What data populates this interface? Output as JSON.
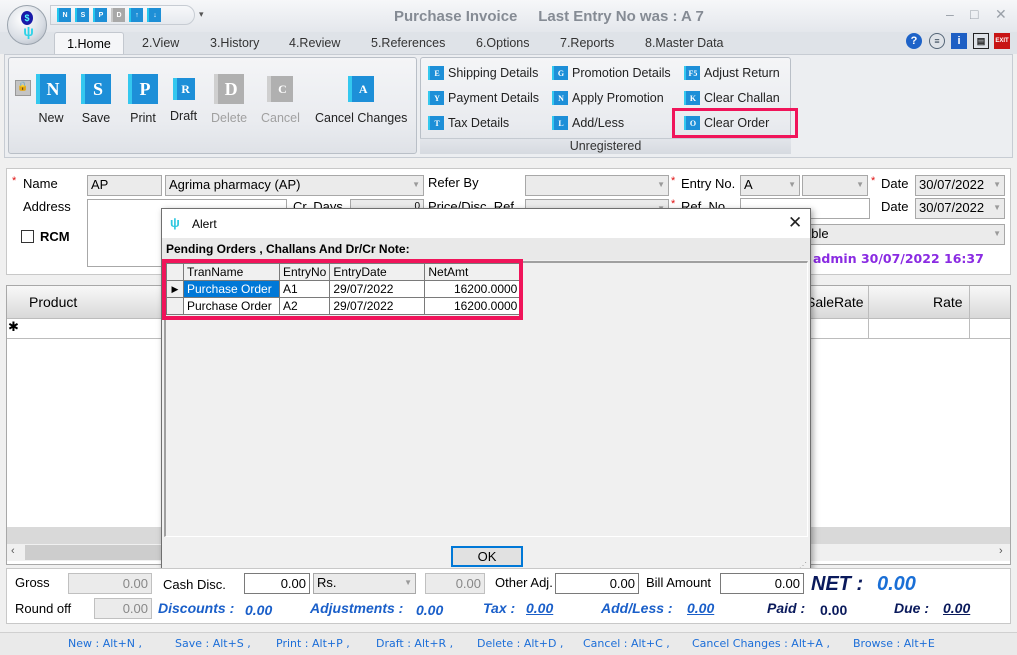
{
  "window": {
    "title": "Purchase Invoice",
    "last_entry": "Last Entry No was : A 7",
    "controls": {
      "minimize": "–",
      "maximize": "□",
      "close": "✕"
    }
  },
  "quick_access": [
    "N",
    "S",
    "P",
    "D",
    "↑",
    "↓"
  ],
  "tabs": [
    {
      "label": "1.Home",
      "active": true
    },
    {
      "label": "2.View"
    },
    {
      "label": "3.History"
    },
    {
      "label": "4.Review"
    },
    {
      "label": "5.References"
    },
    {
      "label": "6.Options"
    },
    {
      "label": "7.Reports"
    },
    {
      "label": "8.Master Data"
    }
  ],
  "top_icons": [
    {
      "name": "help-icon",
      "glyph": "?"
    },
    {
      "name": "database-icon",
      "glyph": "≡"
    },
    {
      "name": "info-icon",
      "glyph": "i"
    },
    {
      "name": "document-icon",
      "glyph": "▤"
    },
    {
      "name": "exit-icon",
      "glyph": "EXIT"
    }
  ],
  "ribbon": {
    "main_buttons": [
      {
        "label": "New",
        "glyph": "N",
        "enabled": true
      },
      {
        "label": "Save",
        "glyph": "S",
        "enabled": true
      },
      {
        "label": "Print",
        "glyph": "P",
        "enabled": true
      },
      {
        "label": "Draft",
        "glyph": "R",
        "enabled": true
      },
      {
        "label": "Delete",
        "glyph": "D",
        "enabled": false
      },
      {
        "label": "Cancel",
        "glyph": "C",
        "enabled": false
      },
      {
        "label": "Cancel Changes",
        "glyph": "A",
        "enabled": true
      }
    ],
    "group_label": "Unregistered",
    "small_buttons": [
      {
        "label": "Shipping Details",
        "glyph": "E"
      },
      {
        "label": "Payment Details",
        "glyph": "Y"
      },
      {
        "label": "Tax Details",
        "glyph": "T"
      },
      {
        "label": "Promotion Details",
        "glyph": "G"
      },
      {
        "label": "Apply Promotion",
        "glyph": "N"
      },
      {
        "label": "Add/Less",
        "glyph": "L"
      },
      {
        "label": "Adjust Return",
        "glyph": "F5"
      },
      {
        "label": "Clear Challan",
        "glyph": "K"
      },
      {
        "label": "Clear Order",
        "glyph": "O"
      }
    ]
  },
  "form": {
    "name_label": "Name",
    "name_code": "AP",
    "name_value": "Agrima pharmacy (AP)",
    "address_label": "Address",
    "address_value": "",
    "rcm_label": "RCM",
    "rcm_checked": false,
    "cr_days_label": "Cr. Days",
    "cr_days_value": "0",
    "refer_by_label": "Refer By",
    "price_disc_label": "Price/Disc. Ref",
    "entry_no_label": "Entry No.",
    "entry_no_series": "A",
    "entry_no_value": "",
    "ref_no_label": "Ref. No.",
    "ref_no_value": "",
    "date_label": "Date",
    "date_value": "30/07/2022",
    "date2_label": "Date",
    "date2_value": "30/07/2022",
    "tax_type_partial": "able",
    "audit_text": "admin 30/07/2022 16:37"
  },
  "grid": {
    "columns": [
      "Product",
      "SaleRate",
      "Rate"
    ],
    "new_row_marker": "✱"
  },
  "dialog": {
    "title": "Alert",
    "message": "Pending Orders , Challans And Dr/Cr Note:",
    "columns": [
      "TranName",
      "EntryNo",
      "EntryDate",
      "NetAmt"
    ],
    "rows": [
      {
        "tran_name": "Purchase Order",
        "entry_no": "A1",
        "entry_date": "29/07/2022",
        "net_amt": "16200.0000",
        "selected": true
      },
      {
        "tran_name": "Purchase Order",
        "entry_no": "A2",
        "entry_date": "29/07/2022",
        "net_amt": "16200.0000",
        "selected": false
      }
    ],
    "ok_label": "OK"
  },
  "totals": {
    "gross_label": "Gross",
    "gross_value": "0.00",
    "cash_disc_label": "Cash Disc.",
    "cash_disc_value": "0.00",
    "cash_disc_unit": "Rs.",
    "cash_disc_amount": "0.00",
    "other_adj_label": "Other Adj.",
    "other_adj_value": "0.00",
    "bill_amount_label": "Bill Amount",
    "bill_amount_value": "0.00",
    "net_label": "NET :",
    "net_value": "0.00",
    "round_off_label": "Round off",
    "round_off_value": "0.00",
    "discounts_label": "Discounts :",
    "discounts_value": "0.00",
    "adjustments_label": "Adjustments :",
    "adjustments_value": "0.00",
    "tax_label": "Tax :",
    "tax_value": "0.00",
    "add_less_label": "Add/Less :",
    "add_less_value": "0.00",
    "paid_label": "Paid :",
    "paid_value": "0.00",
    "due_label": "Due :",
    "due_value": "0.00"
  },
  "shortcuts": [
    "New : Alt+N ,",
    "Save : Alt+S ,",
    "Print : Alt+P ,",
    "Draft : Alt+R ,",
    "Delete : Alt+D ,",
    "Cancel : Alt+C ,",
    "Cancel Changes : Alt+A ,",
    "Browse : Alt+E"
  ]
}
